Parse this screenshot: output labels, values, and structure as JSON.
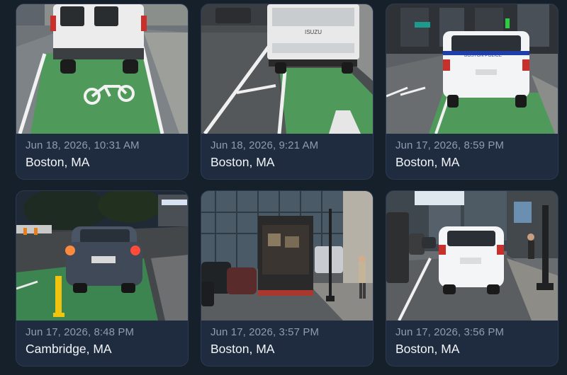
{
  "reports": [
    {
      "timestamp": "Jun 18, 2026, 10:31 AM",
      "location": "Boston, MA",
      "photo": "white-van-in-bike-lane"
    },
    {
      "timestamp": "Jun 18, 2026, 9:21 AM",
      "location": "Boston, MA",
      "photo": "isuzu-truck-in-bike-lane",
      "truck_badge": "ISUZU"
    },
    {
      "timestamp": "Jun 17, 2026, 8:59 PM",
      "location": "Boston, MA",
      "photo": "police-suv-in-bike-lane",
      "vehicle_text": "BOSTON POLICE"
    },
    {
      "timestamp": "Jun 17, 2026, 8:48 PM",
      "location": "Cambridge, MA",
      "photo": "sedan-in-bike-lane-at-night"
    },
    {
      "timestamp": "Jun 17, 2026, 3:57 PM",
      "location": "Boston, MA",
      "photo": "box-truck-on-sidewalk"
    },
    {
      "timestamp": "Jun 17, 2026, 3:56 PM",
      "location": "Boston, MA",
      "photo": "white-suv-in-bike-lane"
    }
  ],
  "colors": {
    "background": "#15202b",
    "card": "#1f2c3f",
    "timestamp_text": "#8e9bb0",
    "location_text": "#f2f5f9",
    "bike_lane_green": "#4f9a5a"
  }
}
